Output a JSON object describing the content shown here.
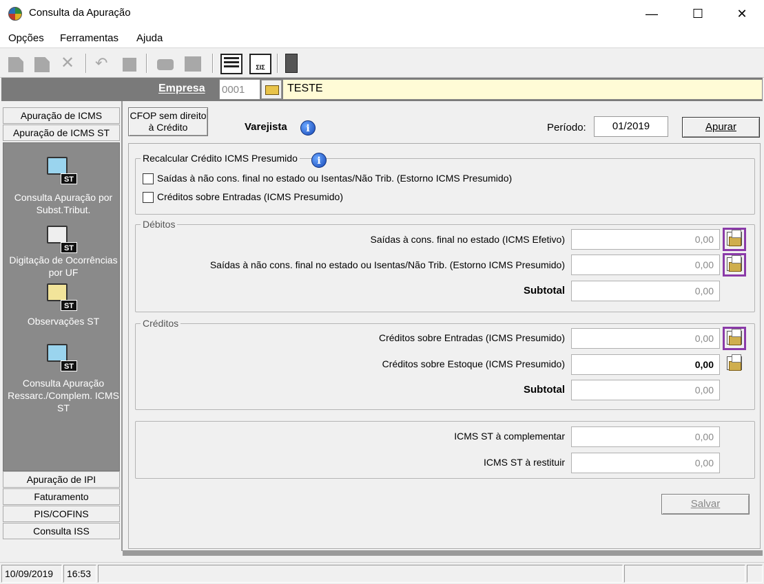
{
  "window": {
    "title": "Consulta da Apuração",
    "minimize": "—",
    "maximize": "☐",
    "close": "✕"
  },
  "menu": [
    "Opções",
    "Ferramentas",
    "Ajuda"
  ],
  "empresa": {
    "label": "Empresa",
    "code": "0001",
    "name": "TESTE"
  },
  "sidebar": {
    "top_tabs": [
      "Apuração de ICMS",
      "Apuração de ICMS ST"
    ],
    "tools": [
      {
        "label": "Consulta  Apuração por Subst.Tribut."
      },
      {
        "label": "Digitação de Ocorrências por UF"
      },
      {
        "label": "Observações ST"
      },
      {
        "label": "Consulta Apuração Ressarc./Complem. ICMS ST"
      }
    ],
    "badge": "ST",
    "bottom_tabs": [
      "Apuração de IPI",
      "Faturamento",
      "PIS/COFINS",
      "Consulta ISS"
    ]
  },
  "header": {
    "cfop_button": "CFOP sem direito à Crédito",
    "regime": "Varejista",
    "info": "i",
    "periodo_label": "Período:",
    "periodo_value": "01/2019",
    "apurar_button": "Apurar"
  },
  "recalcular": {
    "title": "Recalcular Crédito ICMS Presumido",
    "options": [
      "Saídas à não cons. final no estado ou Isentas/Não Trib. (Estorno ICMS Presumido)",
      "Créditos sobre Entradas (ICMS Presumido)"
    ]
  },
  "debitos": {
    "title": "Débitos",
    "rows": [
      {
        "label": "Saídas à cons. final no estado (ICMS Efetivo)",
        "value": "0,00"
      },
      {
        "label": "Saídas à não cons. final no estado ou Isentas/Não Trib. (Estorno ICMS Presumido)",
        "value": "0,00"
      }
    ],
    "subtotal_label": "Subtotal",
    "subtotal_value": "0,00"
  },
  "creditos": {
    "title": "Créditos",
    "rows": [
      {
        "label": "Créditos sobre Entradas (ICMS Presumido)",
        "value": "0,00"
      },
      {
        "label": "Créditos sobre Estoque (ICMS Presumido)",
        "value": "0,00"
      }
    ],
    "subtotal_label": "Subtotal",
    "subtotal_value": "0,00"
  },
  "totais": {
    "rows": [
      {
        "label": "ICMS ST à complementar",
        "value": "0,00"
      },
      {
        "label": "ICMS ST à restituir",
        "value": "0,00"
      }
    ]
  },
  "salvar_button": "Salvar",
  "status": {
    "date": "10/09/2019",
    "time": "16:53"
  },
  "colors": {
    "highlight": "#8a3aa8",
    "empresa_bar": "#7a7a7a",
    "empresa_name_bg": "#fffbd6",
    "sidebar_gray": "#8a8a8a"
  }
}
